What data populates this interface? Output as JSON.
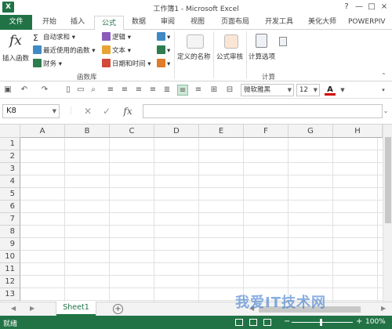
{
  "window": {
    "title": "工作簿1 - Microsoft Excel",
    "logo": "X",
    "controls": [
      "?",
      "—",
      "□",
      "×"
    ]
  },
  "tabs": {
    "file": "文件",
    "items": [
      "开始",
      "插入",
      "公式",
      "数据",
      "审阅",
      "视图",
      "页面布局",
      "开发工具",
      "美化大师",
      "POWERPIV"
    ],
    "active": "公式"
  },
  "ribbon": {
    "insert_function": "插入函数",
    "autosum": "自动求和",
    "recent": "最近使用的函数",
    "financial": "财务",
    "logical": "逻辑",
    "text": "文本",
    "datetime": "日期和时间",
    "library_label": "函数库",
    "defined_names": "定义的名称",
    "formula_audit": "公式审核",
    "calc_options": "计算选项",
    "calc_label": "计算",
    "icon_fx": "fx",
    "icon_sigma": "Σ"
  },
  "toolbar": {
    "font_name": "微软雅黑",
    "font_size": "12"
  },
  "formula_bar": {
    "name_box": "K8",
    "fx": "fx",
    "value": ""
  },
  "grid": {
    "columns": [
      "A",
      "B",
      "C",
      "D",
      "E",
      "F",
      "G",
      "H"
    ],
    "rows": [
      "1",
      "2",
      "3",
      "4",
      "5",
      "6",
      "7",
      "8",
      "9",
      "10",
      "11",
      "12",
      "13"
    ]
  },
  "sheets": {
    "active": "Sheet1",
    "add": "+"
  },
  "status": {
    "ready": "就绪",
    "zoom": "100%"
  },
  "watermark": "我爱IT技术网",
  "colors": {
    "accent": "#217346"
  }
}
